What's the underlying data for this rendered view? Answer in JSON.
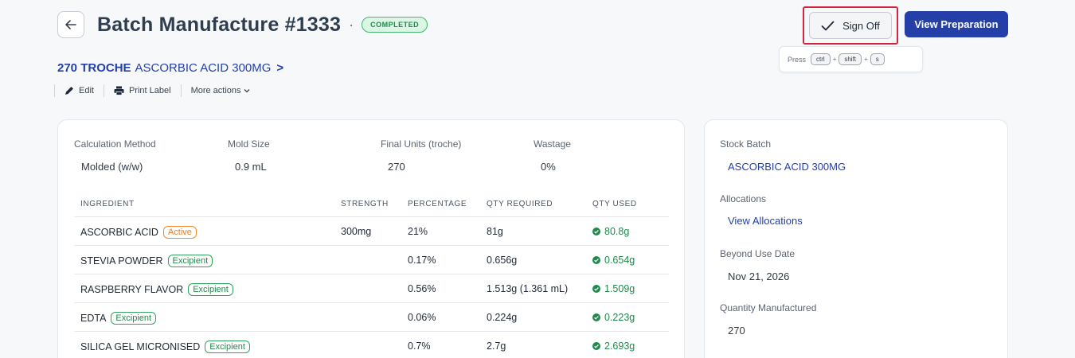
{
  "header": {
    "title": "Batch Manufacture #1333",
    "dot": "·",
    "status": "COMPLETED"
  },
  "product": {
    "strong": "270 TROCHE",
    "name": "ASCORBIC ACID 300MG",
    "chevron": ">"
  },
  "actions": {
    "edit": "Edit",
    "print_label": "Print Label",
    "more": "More actions"
  },
  "toolbar": {
    "sign_off": "Sign Off",
    "view_preparation": "View Preparation"
  },
  "shortcut": {
    "press": "Press",
    "keys": [
      "ctrl",
      "shift",
      "s"
    ],
    "plus": "+"
  },
  "summary": {
    "calc_method_label": "Calculation Method",
    "calc_method_value": "Molded (w/w)",
    "mold_size_label": "Mold Size",
    "mold_size_value": "0.9 mL",
    "final_units_label": "Final Units (troche)",
    "final_units_value": "270",
    "wastage_label": "Wastage",
    "wastage_value": "0%"
  },
  "table": {
    "headers": [
      "INGREDIENT",
      "STRENGTH",
      "PERCENTAGE",
      "QTY REQUIRED",
      "QTY USED"
    ],
    "rows": [
      {
        "name": "ASCORBIC ACID",
        "badge": "Active",
        "strength": "300mg",
        "percentage": "21%",
        "required": "81g",
        "used": "80.8g"
      },
      {
        "name": "STEVIA POWDER",
        "badge": "Excipient",
        "strength": "",
        "percentage": "0.17%",
        "required": "0.656g",
        "used": "0.654g"
      },
      {
        "name": "RASPBERRY FLAVOR",
        "badge": "Excipient",
        "strength": "",
        "percentage": "0.56%",
        "required": "1.513g (1.361 mL)",
        "used": "1.509g"
      },
      {
        "name": "EDTA",
        "badge": "Excipient",
        "strength": "",
        "percentage": "0.06%",
        "required": "0.224g",
        "used": "0.223g"
      },
      {
        "name": "SILICA GEL MICRONISED",
        "badge": "Excipient",
        "strength": "",
        "percentage": "0.7%",
        "required": "2.7g",
        "used": "2.693g"
      }
    ]
  },
  "side": {
    "stock_batch_label": "Stock Batch",
    "stock_batch_value": "ASCORBIC ACID 300MG",
    "allocations_label": "Allocations",
    "allocations_link": "View Allocations",
    "bud_label": "Beyond Use Date",
    "bud_value": "Nov 21, 2026",
    "qty_label": "Quantity Manufactured",
    "qty_value": "270"
  },
  "colors": {
    "primary": "#2440a8",
    "success": "#1f8a4b",
    "warning": "#ea7a1f",
    "highlight": "#d8253e"
  }
}
